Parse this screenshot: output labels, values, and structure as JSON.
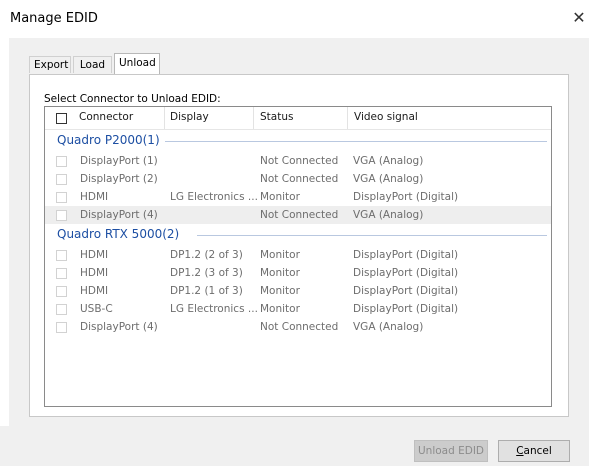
{
  "window": {
    "title": "Manage EDID",
    "close_glyph": "✕"
  },
  "tabs": [
    {
      "label": "Export",
      "active": false
    },
    {
      "label": "Load",
      "active": false
    },
    {
      "label": "Unload",
      "active": true
    }
  ],
  "panel": {
    "section_label": "Select Connector to Unload EDID:",
    "columns": {
      "connector": "Connector",
      "display": "Display",
      "status": "Status",
      "video_signal": "Video signal"
    },
    "groups": [
      {
        "name": "Quadro P2000(1)",
        "rows": [
          {
            "connector": "DisplayPort (1)",
            "display": "",
            "status": "Not Connected",
            "video_signal": "VGA (Analog)"
          },
          {
            "connector": "DisplayPort (2)",
            "display": "",
            "status": "Not Connected",
            "video_signal": "VGA (Analog)"
          },
          {
            "connector": "HDMI",
            "display": "LG Electronics ...",
            "status": "Monitor",
            "video_signal": "DisplayPort (Digital)"
          },
          {
            "connector": "DisplayPort (4)",
            "display": "",
            "status": "Not Connected",
            "video_signal": "VGA (Analog)"
          }
        ]
      },
      {
        "name": "Quadro RTX 5000(2)",
        "rows": [
          {
            "connector": "HDMI",
            "display": "DP1.2 (2 of 3)",
            "status": "Monitor",
            "video_signal": "DisplayPort (Digital)"
          },
          {
            "connector": "HDMI",
            "display": "DP1.2 (3 of 3)",
            "status": "Monitor",
            "video_signal": "DisplayPort (Digital)"
          },
          {
            "connector": "HDMI",
            "display": "DP1.2 (1 of 3)",
            "status": "Monitor",
            "video_signal": "DisplayPort (Digital)"
          },
          {
            "connector": "USB-C",
            "display": "LG Electronics ...",
            "status": "Monitor",
            "video_signal": "DisplayPort (Digital)"
          },
          {
            "connector": "DisplayPort (4)",
            "display": "",
            "status": "Not Connected",
            "video_signal": "VGA (Analog)"
          }
        ]
      }
    ]
  },
  "buttons": {
    "unload": "Unload EDID",
    "cancel_mnemonic": "C",
    "cancel_rest": "ancel"
  }
}
